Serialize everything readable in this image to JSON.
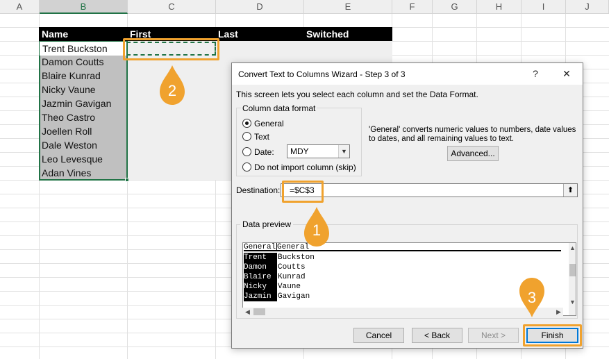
{
  "columns": [
    "A",
    "B",
    "C",
    "D",
    "E",
    "F",
    "G",
    "H",
    "I",
    "J"
  ],
  "active_column": "B",
  "table": {
    "headers": [
      "Name",
      "First",
      "Last",
      "Switched"
    ],
    "names": [
      "Trent Buckston",
      "Damon Coutts",
      "Blaire Kunrad",
      "Nicky Vaune",
      "Jazmin Gavigan",
      "Theo Castro",
      "Joellen Roll",
      "Dale Weston",
      "Leo Levesque",
      "Adan Vines"
    ]
  },
  "dialog": {
    "title": "Convert Text to Columns Wizard - Step 3 of 3",
    "help": "?",
    "close": "✕",
    "intro": "This screen lets you select each column and set the Data Format.",
    "format_group": "Column data format",
    "radios": {
      "general": "General",
      "text": "Text",
      "date": "Date:",
      "skip": "Do not import column (skip)"
    },
    "date_format": "MDY",
    "description": "'General' converts numeric values to numbers, date values to dates, and all remaining values to text.",
    "advanced": "Advanced...",
    "destination_label": "Destination:",
    "destination_value": "=$C$3",
    "preview_label": "Data preview",
    "preview": {
      "headers": [
        "General",
        "General"
      ],
      "rows": [
        [
          "Trent",
          "Buckston"
        ],
        [
          "Damon",
          "Coutts"
        ],
        [
          "Blaire",
          "Kunrad"
        ],
        [
          "Nicky",
          "Vaune"
        ],
        [
          "Jazmin",
          "Gavigan"
        ]
      ]
    },
    "buttons": {
      "cancel": "Cancel",
      "back": "< Back",
      "next": "Next >",
      "finish": "Finish"
    }
  },
  "callouts": [
    "1",
    "2",
    "3"
  ],
  "colors": {
    "accent_orange": "#f0a22e",
    "excel_green": "#217346",
    "focus_blue": "#0078d7"
  }
}
